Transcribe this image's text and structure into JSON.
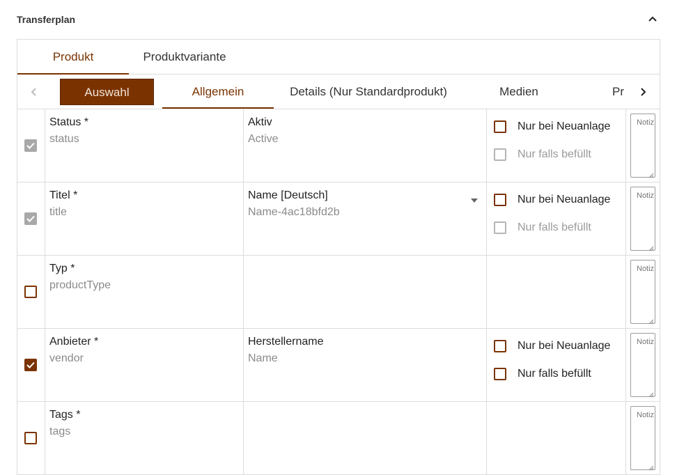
{
  "panel": {
    "title": "Transferplan",
    "collapse_icon": "chevron-up-icon"
  },
  "main_tabs": [
    {
      "label": "Produkt",
      "active": true
    },
    {
      "label": "Produktvariante",
      "active": false
    }
  ],
  "sub_tabs": [
    {
      "label": "Auswahl",
      "style": "selected-button"
    },
    {
      "label": "Allgemein",
      "active": true
    },
    {
      "label": "Details (Nur Standardprodukt)"
    },
    {
      "label": "Medien"
    },
    {
      "label": "Pr"
    }
  ],
  "sub_tab_icons": {
    "prev": "chevron-left-icon",
    "next": "chevron-right-icon"
  },
  "rows": [
    {
      "checked": true,
      "disabled": true,
      "field_label": "Status *",
      "field_key": "status",
      "map_label": "Aktiv",
      "map_value": "Active",
      "has_dropdown": false,
      "options": [
        {
          "label": "Nur bei Neuanlage",
          "checked": false,
          "disabled": false
        },
        {
          "label": "Nur falls befüllt",
          "checked": false,
          "disabled": true
        }
      ],
      "note_placeholder": "Notiz"
    },
    {
      "checked": true,
      "disabled": true,
      "field_label": "Titel *",
      "field_key": "title",
      "map_label": "Name [Deutsch]",
      "map_value": "Name-4ac18bfd2b",
      "has_dropdown": true,
      "options": [
        {
          "label": "Nur bei Neuanlage",
          "checked": false,
          "disabled": false
        },
        {
          "label": "Nur falls befüllt",
          "checked": false,
          "disabled": true
        }
      ],
      "note_placeholder": "Notiz"
    },
    {
      "checked": false,
      "disabled": false,
      "field_label": "Typ *",
      "field_key": "productType",
      "map_label": "",
      "map_value": "",
      "has_dropdown": false,
      "options": [],
      "note_placeholder": "Notiz"
    },
    {
      "checked": true,
      "disabled": false,
      "field_label": "Anbieter *",
      "field_key": "vendor",
      "map_label": "Herstellername",
      "map_value": "Name",
      "has_dropdown": false,
      "options": [
        {
          "label": "Nur bei Neuanlage",
          "checked": false,
          "disabled": false
        },
        {
          "label": "Nur falls befüllt",
          "checked": false,
          "disabled": false
        }
      ],
      "note_placeholder": "Notiz"
    },
    {
      "checked": false,
      "disabled": false,
      "field_label": "Tags *",
      "field_key": "tags",
      "map_label": "",
      "map_value": "",
      "has_dropdown": false,
      "options": [],
      "note_placeholder": "Notiz"
    }
  ],
  "colors": {
    "accent": "#7a3300",
    "border": "#dcdcdc",
    "muted": "#8a8a8a",
    "disabled": "#a8a8a8"
  }
}
